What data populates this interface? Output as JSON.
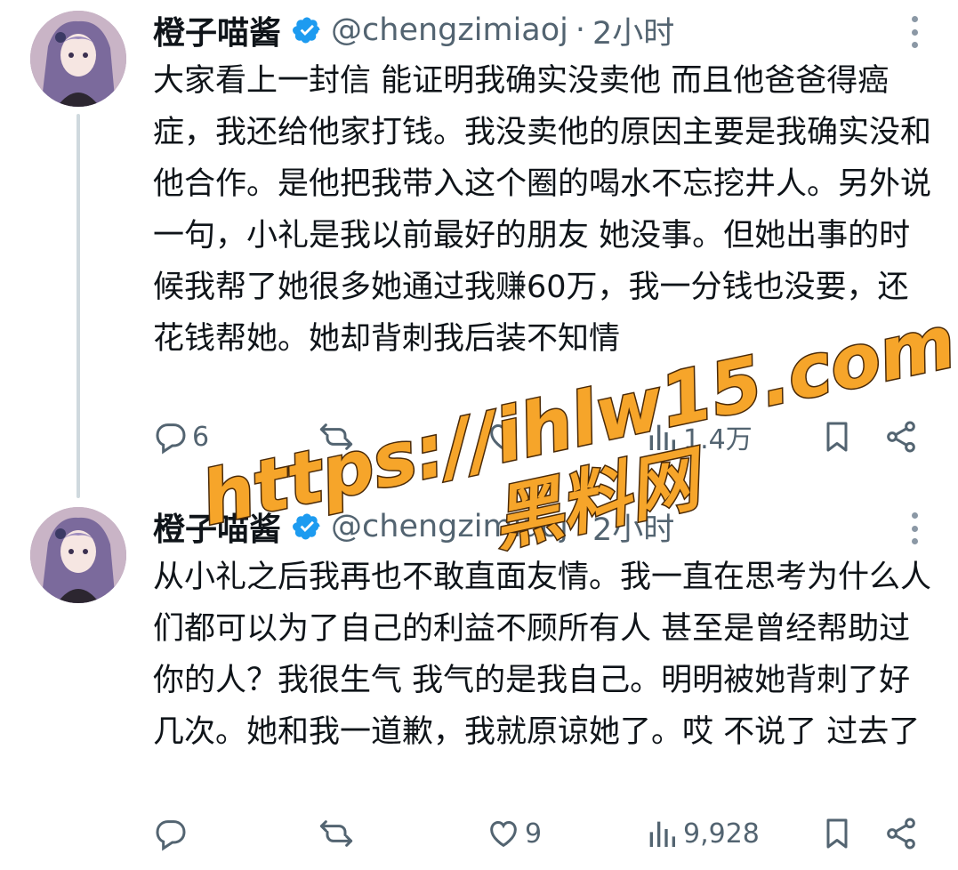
{
  "tweets": [
    {
      "author_name": "橙子喵酱",
      "handle": "@chengzimiaoj",
      "separator": "·",
      "time": "2小时",
      "text": "大家看上一封信 能证明我确实没卖他 而且他爸爸得癌症，我还给他家打钱。我没卖他的原因主要是我确实没和他合作。是他把我带入这个圈的喝水不忘挖井人。另外说一句，小礼是我以前最好的朋友 她没事。但她出事的时候我帮了她很多她通过我赚60万，我一分钱也没要，还花钱帮她。她却背刺我后装不知情",
      "reply_count": "6",
      "retweet_count": "",
      "like_count": "",
      "view_count": "1.4万"
    },
    {
      "author_name": "橙子喵酱",
      "handle": "@chengzimiaoj",
      "separator": "·",
      "time": "2小时",
      "text": "从小礼之后我再也不敢直面友情。我一直在思考为什么人们都可以为了自己的利益不顾所有人 甚至是曾经帮助过你的人？我很生气 我气的是我自己。明明被她背刺了好几次。她和我一道歉，我就原谅她了。哎 不说了 过去了",
      "reply_count": "",
      "retweet_count": "",
      "like_count": "9",
      "view_count": "9,928"
    }
  ],
  "watermark": {
    "line1": "https://ihlw15.com",
    "line2": "黑料网"
  },
  "icons": {
    "verified": "verified-badge-icon",
    "more": "more-options-icon",
    "reply": "reply-icon",
    "retweet": "retweet-icon",
    "like": "like-icon",
    "views": "views-icon",
    "bookmark": "bookmark-icon",
    "share": "share-icon"
  },
  "colors": {
    "text": "#0f1419",
    "secondary": "#536471",
    "verified": "#1d9bf0",
    "thread_line": "#cfd9de",
    "watermark_fill": "#f6a52a"
  }
}
